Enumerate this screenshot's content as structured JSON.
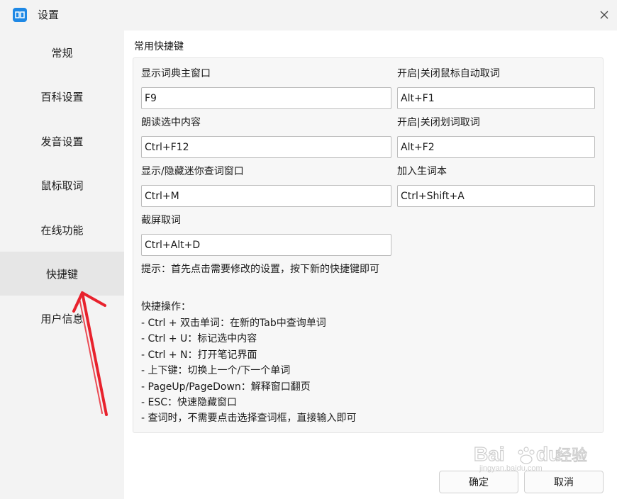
{
  "window": {
    "title": "设置",
    "app_icon": "dictionary-app-icon",
    "close_icon": "close-icon"
  },
  "sidebar": {
    "items": [
      {
        "label": "常规"
      },
      {
        "label": "百科设置"
      },
      {
        "label": "发音设置"
      },
      {
        "label": "鼠标取词"
      },
      {
        "label": "在线功能"
      },
      {
        "label": "快捷键",
        "active": true
      },
      {
        "label": "用户信息"
      }
    ]
  },
  "shortcuts": {
    "section_title": "常用快捷键",
    "fields": [
      {
        "label": "显示词典主窗口",
        "value": "F9"
      },
      {
        "label": "开启|关闭鼠标自动取词",
        "value": "Alt+F1"
      },
      {
        "label": "朗读选中内容",
        "value": "Ctrl+F12"
      },
      {
        "label": "开启|关闭划词取词",
        "value": "Alt+F2"
      },
      {
        "label": "显示/隐藏迷你查词窗口",
        "value": "Ctrl+M"
      },
      {
        "label": "加入生词本",
        "value": "Ctrl+Shift+A"
      },
      {
        "label": "截屏取词",
        "value": "Ctrl+Alt+D"
      }
    ],
    "tip": "提示：首先点击需要修改的设置，按下新的快捷键即可",
    "ops_title": "快捷操作：",
    "ops": [
      "- Ctrl + 双击单词：在新的Tab中查询单词",
      "- Ctrl + U：标记选中内容",
      "- Ctrl + N：打开笔记界面",
      "- 上下键：切换上一个/下一个单词",
      "- PageUp/PageDown：解释窗口翻页",
      "- ESC：快速隐藏窗口",
      "- 查词时，不需要点击选择查词框，直接输入即可"
    ]
  },
  "footer": {
    "ok_label": "确定",
    "cancel_label": "取消"
  },
  "watermark": {
    "brand": "Bai",
    "brand_tail": "du",
    "suffix": "经验",
    "url": "jingyan.baidu.com"
  },
  "colors": {
    "accent": "#1e88e5",
    "arrow": "#e8222d"
  }
}
